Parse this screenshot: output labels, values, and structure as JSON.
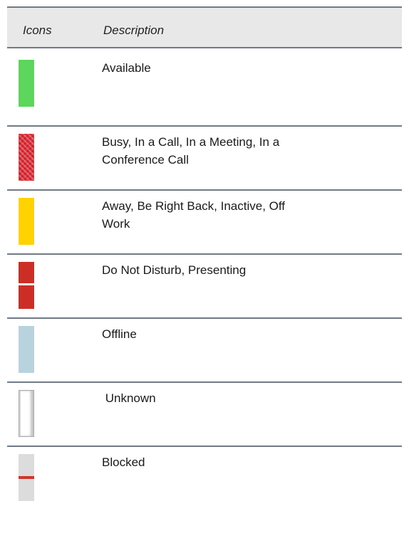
{
  "table": {
    "header": {
      "icons": "Icons",
      "description": "Description"
    },
    "rows": [
      {
        "icon": "available-status-icon",
        "color": "#5cd65c",
        "description": "Available"
      },
      {
        "icon": "busy-status-icon",
        "color": "#e0303a",
        "description_line1": "Busy, In a Call, In a Meeting, In a",
        "description_line2": "Conference Call"
      },
      {
        "icon": "away-status-icon",
        "color": "#ffd200",
        "description_line1": "Away, Be Right Back, Inactive, Off",
        "description_line2": "Work"
      },
      {
        "icon": "do-not-disturb-status-icon",
        "color": "#cc2e26",
        "description": "Do Not Disturb, Presenting"
      },
      {
        "icon": "offline-status-icon",
        "color": "#b9d3de",
        "description": "Offline"
      },
      {
        "icon": "unknown-status-icon",
        "color": "#ffffff",
        "description": " Unknown"
      },
      {
        "icon": "blocked-status-icon",
        "color": "#dcdcdc",
        "description": "Blocked"
      }
    ]
  }
}
